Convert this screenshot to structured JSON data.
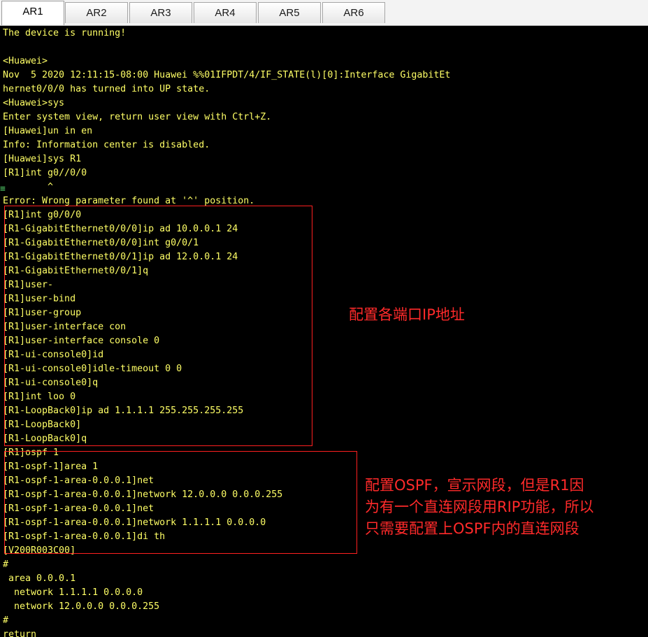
{
  "tabs": [
    {
      "label": "AR1",
      "active": true
    },
    {
      "label": "AR2",
      "active": false
    },
    {
      "label": "AR3",
      "active": false
    },
    {
      "label": "AR4",
      "active": false
    },
    {
      "label": "AR5",
      "active": false
    },
    {
      "label": "AR6",
      "active": false
    }
  ],
  "terminal": {
    "lines": [
      "The device is running!",
      "",
      "<Huawei>",
      "Nov  5 2020 12:11:15-08:00 Huawei %%01IFPDT/4/IF_STATE(l)[0]:Interface GigabitEt",
      "hernet0/0/0 has turned into UP state.",
      "<Huawei>sys",
      "Enter system view, return user view with Ctrl+Z.",
      "[Huawei]un in en",
      "Info: Information center is disabled.",
      "[Huawei]sys R1",
      "[R1]int g0//0/0",
      "        ^",
      "Error: Wrong parameter found at '^' position.",
      "[R1]int g0/0/0",
      "[R1-GigabitEthernet0/0/0]ip ad 10.0.0.1 24",
      "[R1-GigabitEthernet0/0/0]int g0/0/1",
      "[R1-GigabitEthernet0/0/1]ip ad 12.0.0.1 24",
      "[R1-GigabitEthernet0/0/1]q",
      "[R1]user-",
      "[R1]user-bind",
      "[R1]user-group",
      "[R1]user-interface con",
      "[R1]user-interface console 0",
      "[R1-ui-console0]id",
      "[R1-ui-console0]idle-timeout 0 0",
      "[R1-ui-console0]q",
      "[R1]int loo 0",
      "[R1-LoopBack0]ip ad 1.1.1.1 255.255.255.255",
      "[R1-LoopBack0]",
      "[R1-LoopBack0]q",
      "[R1]ospf 1",
      "[R1-ospf-1]area 1",
      "[R1-ospf-1-area-0.0.0.1]net",
      "[R1-ospf-1-area-0.0.0.1]network 12.0.0.0 0.0.0.255",
      "[R1-ospf-1-area-0.0.0.1]net",
      "[R1-ospf-1-area-0.0.0.1]network 1.1.1.1 0.0.0.0",
      "[R1-ospf-1-area-0.0.0.1]di th",
      "[V200R003C00]",
      "#",
      " area 0.0.0.1",
      "  network 1.1.1.1 0.0.0.0",
      "  network 12.0.0.0 0.0.0.255",
      "#",
      "return"
    ]
  },
  "annotations": {
    "interfaces": "配置各端口IP地址",
    "ospf": [
      "配置OSPF，宣示网段，但是R1因",
      "为有一个直连网段用RIP功能，所以",
      "只需要配置上OSPF内的直连网段"
    ]
  },
  "colors": {
    "terminal_background": "#000000",
    "terminal_text": "#ffff66",
    "annotation": "#ff2a2a"
  }
}
